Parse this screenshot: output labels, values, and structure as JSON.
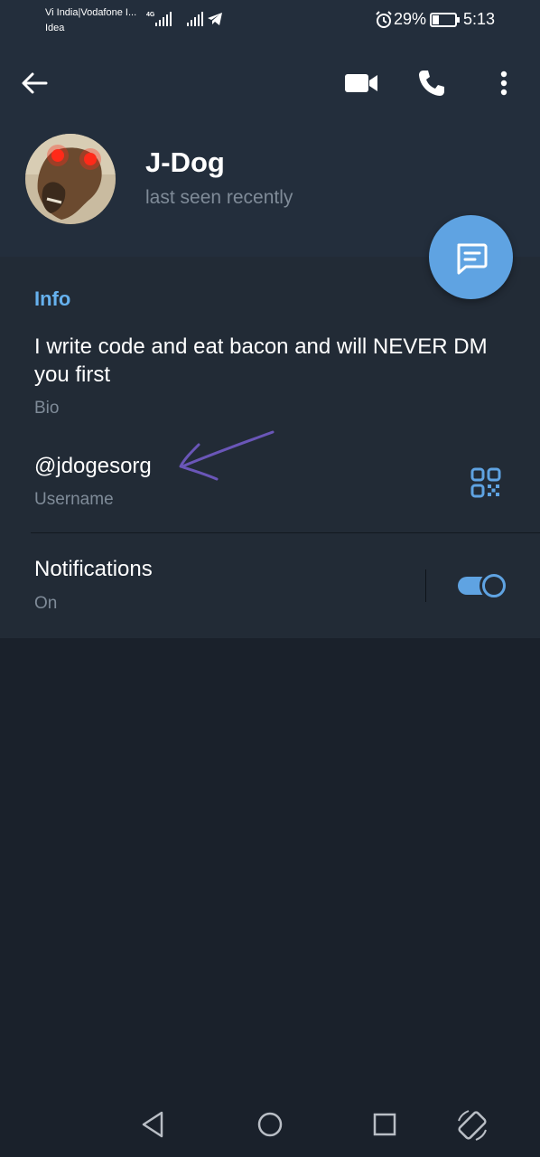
{
  "status_bar": {
    "carrier_line1": "Vi India|Vodafone I...",
    "carrier_line2": "Idea",
    "network_type": "4G",
    "battery_percent": "29%",
    "battery_level": 0.29,
    "time": "5:13"
  },
  "header": {
    "contact_name": "J-Dog",
    "last_seen": "last seen recently"
  },
  "info": {
    "section_title": "Info",
    "bio_text": "I write code and eat bacon and will NEVER DM you first",
    "bio_label": "Bio",
    "username": "@jdogesorg",
    "username_label": "Username"
  },
  "notifications": {
    "title": "Notifications",
    "value": "On",
    "enabled": true
  },
  "colors": {
    "accent": "#5fa3e2",
    "info_header": "#66b1ee",
    "header_bg": "#232e3c",
    "page_bg": "#1a212b",
    "section_bg": "#222b36",
    "secondary_text": "#7f8b98",
    "annotation_arrow": "#6a56b8"
  },
  "icons": {
    "back": "arrow-left-icon",
    "video": "video-camera-icon",
    "call": "phone-icon",
    "more": "more-vertical-icon",
    "message_fab": "message-icon",
    "qr": "qr-code-icon",
    "nav_back": "triangle-back-icon",
    "nav_home": "circle-home-icon",
    "nav_recent": "square-recents-icon",
    "nav_rotate": "rotate-screen-icon"
  }
}
